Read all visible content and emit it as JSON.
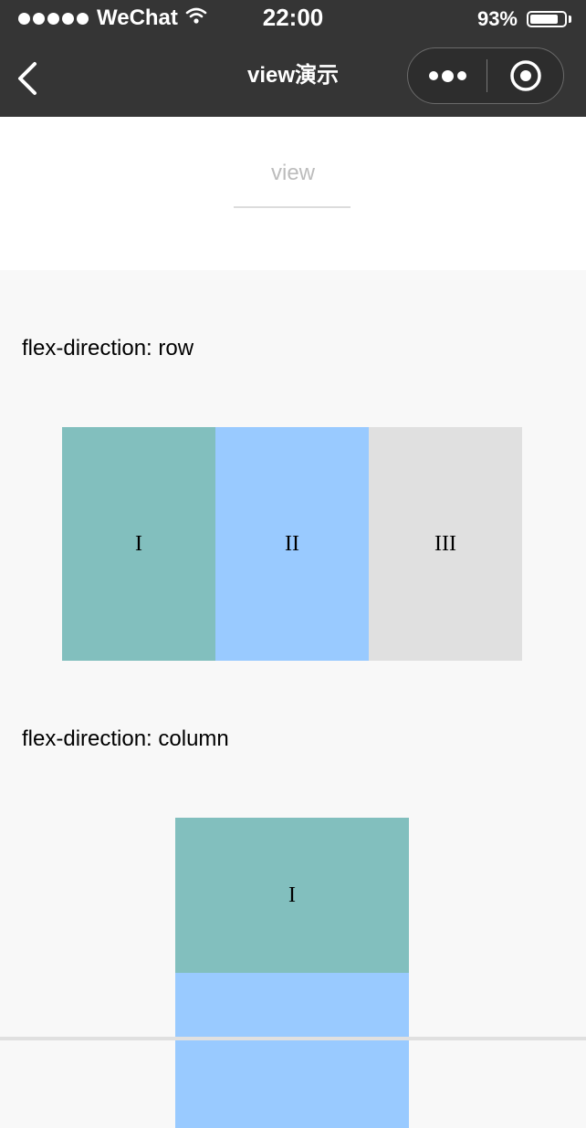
{
  "status_bar": {
    "carrier": "WeChat",
    "time": "22:00",
    "battery": "93%",
    "battery_level": 0.93,
    "signal_dots": 5
  },
  "nav": {
    "title": "view演示",
    "back_icon": "back-chevron-icon",
    "more_icon": "more-dots-icon",
    "close_icon": "target-circle-icon"
  },
  "header": {
    "title": "view"
  },
  "sections": [
    {
      "label": "flex-direction: row",
      "items": [
        "I",
        "II",
        "III"
      ]
    },
    {
      "label": "flex-direction: column",
      "items": [
        "I",
        ""
      ]
    }
  ],
  "colors": {
    "nav_bg": "#353535",
    "item_1": "#82bfbe",
    "item_2": "#99caff",
    "item_3": "#e0e0e0",
    "page_bg": "#f8f8f8"
  }
}
